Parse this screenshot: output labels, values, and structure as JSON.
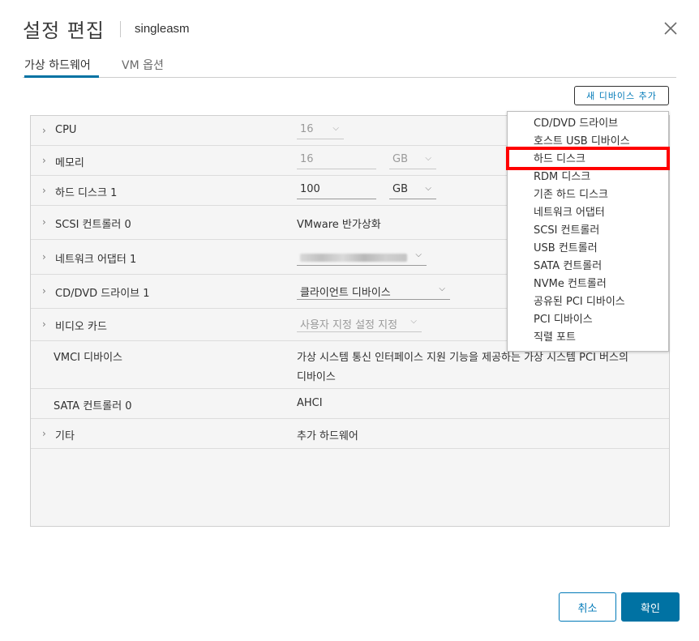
{
  "header": {
    "title": "설정 편집",
    "vm_name": "singleasm",
    "close_icon": "close-icon"
  },
  "tabs": [
    {
      "label": "가상 하드웨어",
      "active": true
    },
    {
      "label": "VM 옵션",
      "active": false
    }
  ],
  "toolbar": {
    "add_device_label": "새 디바이스 추가"
  },
  "hardware": {
    "cpu": {
      "label": "CPU",
      "value": "16"
    },
    "memory": {
      "label": "메모리",
      "value": "16",
      "unit": "GB"
    },
    "hard_disk": {
      "label": "하드 디스크 1",
      "value": "100",
      "unit": "GB"
    },
    "scsi": {
      "label": "SCSI 컨트롤러 0",
      "value": "VMware 반가상화"
    },
    "network": {
      "label": "네트워크 어댑터 1"
    },
    "cddvd": {
      "label": "CD/DVD 드라이브 1",
      "value": "클라이언트 디바이스"
    },
    "video": {
      "label": "비디오 카드",
      "value": "사용자 지정 설정 지정"
    },
    "vmci": {
      "label": "VMCI 디바이스",
      "value_line1": "가상 시스템 통신 인터페이스 지원 기능을 제공하는 가상 시스템 PCI 버스의",
      "value_line2": "디바이스"
    },
    "sata": {
      "label": "SATA 컨트롤러 0",
      "value": "AHCI"
    },
    "other": {
      "label": "기타",
      "value": "추가 하드웨어"
    }
  },
  "menu": {
    "items": [
      "CD/DVD 드라이브",
      "호스트 USB 디바이스",
      "하드 디스크",
      "RDM 디스크",
      "기존 하드 디스크",
      "네트워크 어댑터",
      "SCSI 컨트롤러",
      "USB 컨트롤러",
      "SATA 컨트롤러",
      "NVMe 컨트롤러",
      "공유된 PCI 디바이스",
      "PCI 디바이스",
      "직렬 포트"
    ],
    "highlighted_index": 2
  },
  "footer": {
    "cancel_label": "취소",
    "ok_label": "확인"
  },
  "colors": {
    "accent": "#0072a3",
    "link": "#0079b8",
    "highlight": "#ff0000"
  }
}
